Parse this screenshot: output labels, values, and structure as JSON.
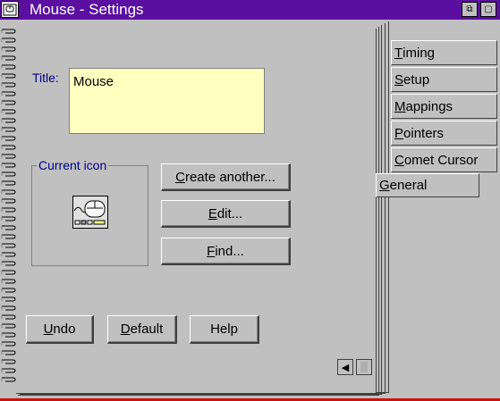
{
  "window": {
    "title": "Mouse - Settings",
    "sysmenu_icon": "mouse-window-icon",
    "restore_icon": "restore-icon",
    "close_icon": "close-icon"
  },
  "form": {
    "title_label": "Title:",
    "title_value": "Mouse",
    "group_label": "Current icon",
    "icon_name": "mouse-icon"
  },
  "buttons": {
    "create": {
      "mn": "C",
      "rest": "reate another..."
    },
    "edit": {
      "mn": "E",
      "rest": "dit..."
    },
    "find": {
      "mn": "F",
      "rest": "ind..."
    },
    "undo": {
      "mn": "U",
      "rest": "ndo"
    },
    "default": {
      "mn": "D",
      "rest": "efault"
    },
    "help": {
      "label": "Help"
    }
  },
  "tabs": [
    {
      "mn": "T",
      "rest": "iming"
    },
    {
      "mn": "S",
      "rest": "etup"
    },
    {
      "mn": "M",
      "rest": "appings"
    },
    {
      "mn": "P",
      "rest": "ointers"
    },
    {
      "mn": "C",
      "rest": "omet Cursor"
    },
    {
      "mn": "G",
      "rest": "eneral"
    }
  ],
  "active_tab": "General",
  "page_nav": {
    "prev_icon": "left-arrow-icon",
    "next_icon": "right-arrow-disabled-icon"
  },
  "colors": {
    "title_bar": "#5a0fa0",
    "label_text": "#00008b",
    "title_field_bg": "#ffffc0"
  }
}
